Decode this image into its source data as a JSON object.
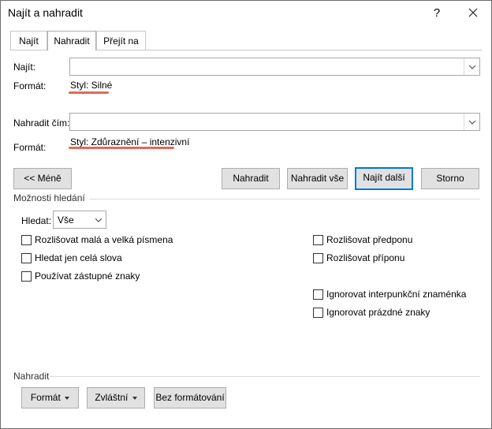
{
  "window": {
    "title": "Najít a nahradit",
    "help": "?",
    "close": "close"
  },
  "tabs": [
    {
      "label": "Najít",
      "selected": false
    },
    {
      "label": "Nahradit",
      "selected": true
    },
    {
      "label": "Přejít na",
      "selected": false
    }
  ],
  "find": {
    "label": "Najít:",
    "value": "",
    "format_label": "Formát:",
    "format_value": "Styl: Silné"
  },
  "replace": {
    "label": "Nahradit čím:",
    "value": "",
    "format_label": "Formát:",
    "format_value": "Styl: Zdůraznění – intenzivní"
  },
  "buttons": {
    "less": "<< Méně",
    "replace": "Nahradit",
    "replace_all": "Nahradit vše",
    "find_next": "Najít další",
    "cancel": "Storno"
  },
  "options": {
    "section_title": "Možnosti hledání",
    "search_label": "Hledat:",
    "search_value": "Vše",
    "left": [
      {
        "label": "Rozlišovat malá a velká písmena",
        "checked": false
      },
      {
        "label": "Hledat jen celá slova",
        "checked": false
      },
      {
        "label": "Používat zástupné znaky",
        "checked": false
      }
    ],
    "right": [
      {
        "label": "Rozlišovat předponu",
        "checked": false
      },
      {
        "label": "Rozlišovat příponu",
        "checked": false
      },
      {
        "label": "Ignorovat interpunkční znaménka",
        "checked": false
      },
      {
        "label": "Ignorovat prázdné znaky",
        "checked": false
      }
    ]
  },
  "replace_section": {
    "title": "Nahradit",
    "format_button": "Formát",
    "special_button": "Zvláštní",
    "no_format_button": "Bez formátování"
  },
  "colors": {
    "accent": "#0078d7",
    "annotation": "#e06a5d"
  }
}
